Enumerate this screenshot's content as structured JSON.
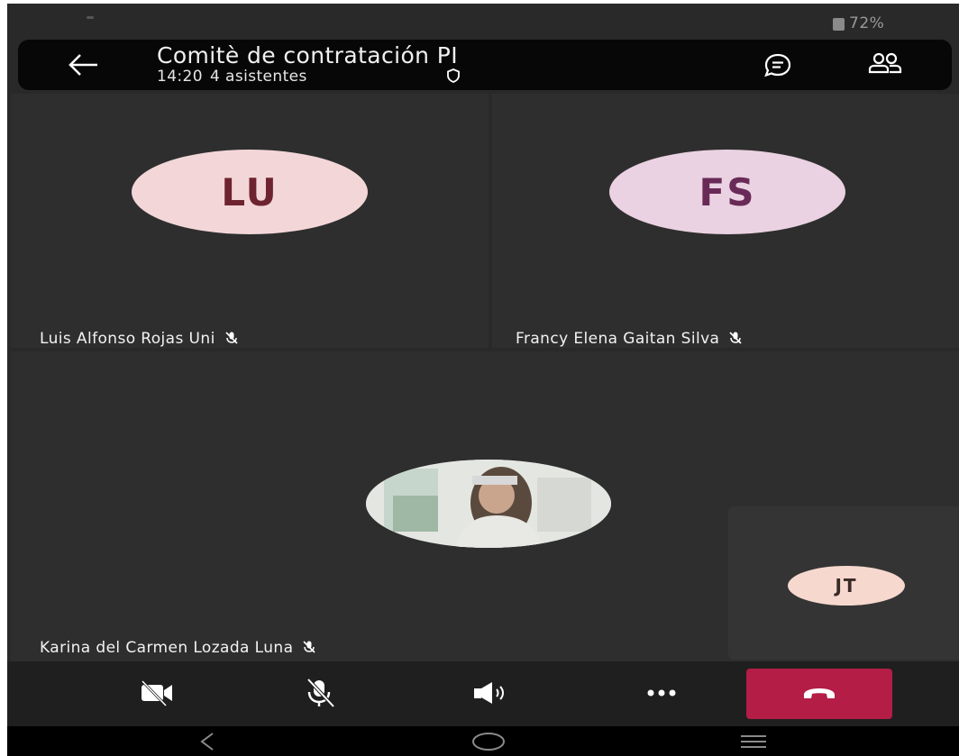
{
  "status_bar": {
    "battery": "72%"
  },
  "header": {
    "title": "Comitè de contratación PI",
    "time": "14:20",
    "attendees": "4 asistentes",
    "icons": [
      "back-arrow-icon",
      "shield-icon",
      "chat-icon",
      "people-icon"
    ]
  },
  "participants": [
    {
      "initials": "LU",
      "name": "Luis Alfonso Rojas Uni",
      "muted": true,
      "avatar_color": "#f3d7d8"
    },
    {
      "initials": "FS",
      "name": "Francy Elena Gaitan Silva",
      "muted": true,
      "avatar_color": "#ead2e2"
    },
    {
      "initials": "",
      "name": "Karina del Carmen Lozada Luna",
      "muted": true,
      "has_photo": true
    },
    {
      "initials": "JT",
      "name": "",
      "muted": false,
      "avatar_color": "#f6d8cf"
    }
  ],
  "toolbar": {
    "buttons": [
      "video-off-icon",
      "mic-off-icon",
      "speaker-icon",
      "more-options-icon",
      "hang-up-icon"
    ],
    "hangup_color": "#b31d46"
  },
  "nav_bar": {
    "icons": [
      "nav-back-icon",
      "nav-home-icon",
      "nav-recents-icon"
    ]
  }
}
